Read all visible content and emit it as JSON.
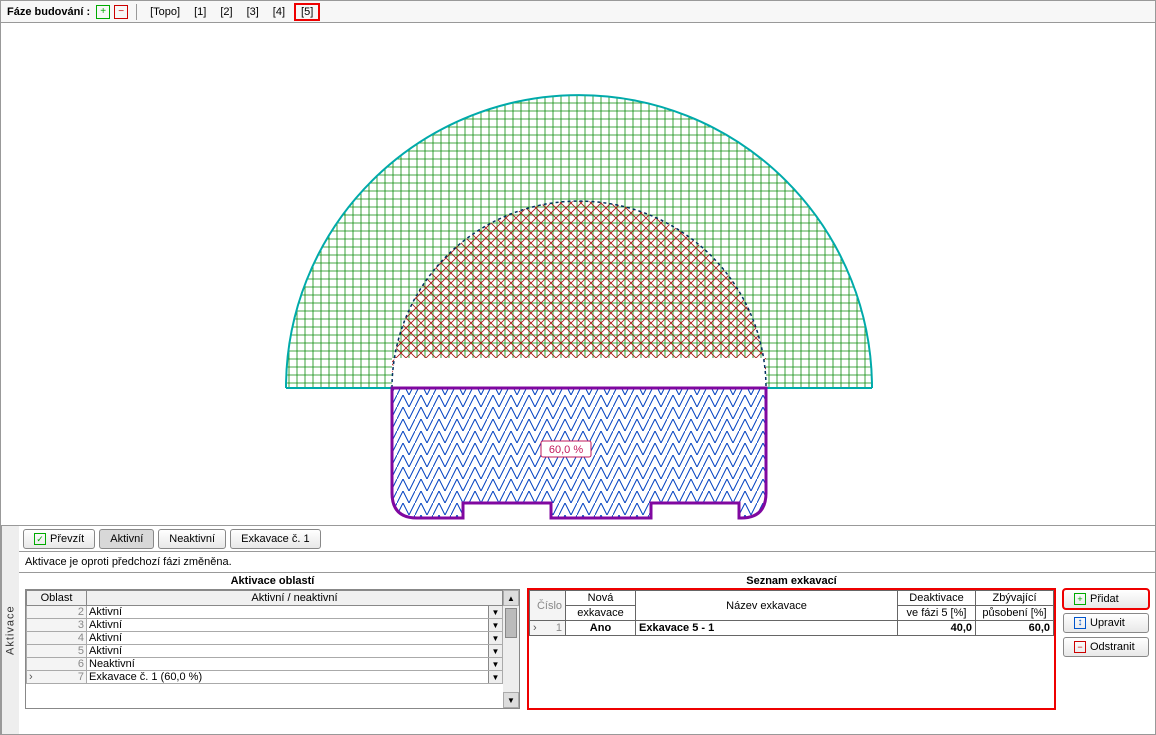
{
  "phasebar": {
    "label": "Fáze budování :",
    "tabs": [
      "[Topo]",
      "[1]",
      "[2]",
      "[3]",
      "[4]",
      "[5]"
    ],
    "selected": 5
  },
  "viewport": {
    "badge_text": "60,0 %"
  },
  "panel": {
    "take_over_label": "Převzít",
    "active_btn": "Aktivní",
    "inactive_btn": "Neaktivní",
    "exc_btn": "Exkavace č. 1",
    "status_msg": "Aktivace je oproti předchozí fázi změněna."
  },
  "side_tab_label": "Aktivace",
  "areas": {
    "group_title": "Aktivace oblastí",
    "header_num": "Oblast",
    "header_state": "Aktivní / neaktivní",
    "rows": [
      {
        "n": "2",
        "state": "Aktivní",
        "sel": false
      },
      {
        "n": "3",
        "state": "Aktivní",
        "sel": false
      },
      {
        "n": "4",
        "state": "Aktivní",
        "sel": false
      },
      {
        "n": "5",
        "state": "Aktivní",
        "sel": false
      },
      {
        "n": "6",
        "state": "Neaktivní",
        "sel": false
      },
      {
        "n": "7",
        "state": "Exkavace č. 1 (60,0 %)",
        "sel": true
      }
    ]
  },
  "excavations": {
    "group_title": "Seznam exkavací",
    "header_num": "Číslo",
    "header_new1": "Nová",
    "header_new2": "exkavace",
    "header_name": "Název exkavace",
    "header_deact1": "Deaktivace",
    "header_deact2": "ve fázi 5 [%]",
    "header_rem1": "Zbývající",
    "header_rem2": "působení [%]",
    "rows": [
      {
        "n": "1",
        "is_new": "Ano",
        "name": "Exkavace 5 - 1",
        "deact": "40,0",
        "remain": "60,0",
        "sel": true
      }
    ]
  },
  "actions": {
    "add": "Přidat",
    "edit": "Upravit",
    "remove": "Odstranit"
  },
  "chart_data": {
    "type": "diagram",
    "description": "Tunnel cross-section with three hatched regions and a percentage badge inside the lower region.",
    "regions": [
      {
        "name": "outer-upper",
        "shape": "half-circle + rectangle base",
        "hatch": "green-grid",
        "outline": "teal"
      },
      {
        "name": "inner-upper",
        "shape": "half-circle",
        "hatch": "red-cross",
        "outline": "navy-dashed"
      },
      {
        "name": "lower",
        "shape": "notched-rectangle",
        "hatch": "blue-zigzag",
        "outline": "purple"
      }
    ],
    "badge": {
      "text": "60,0 %",
      "region": "lower"
    }
  }
}
